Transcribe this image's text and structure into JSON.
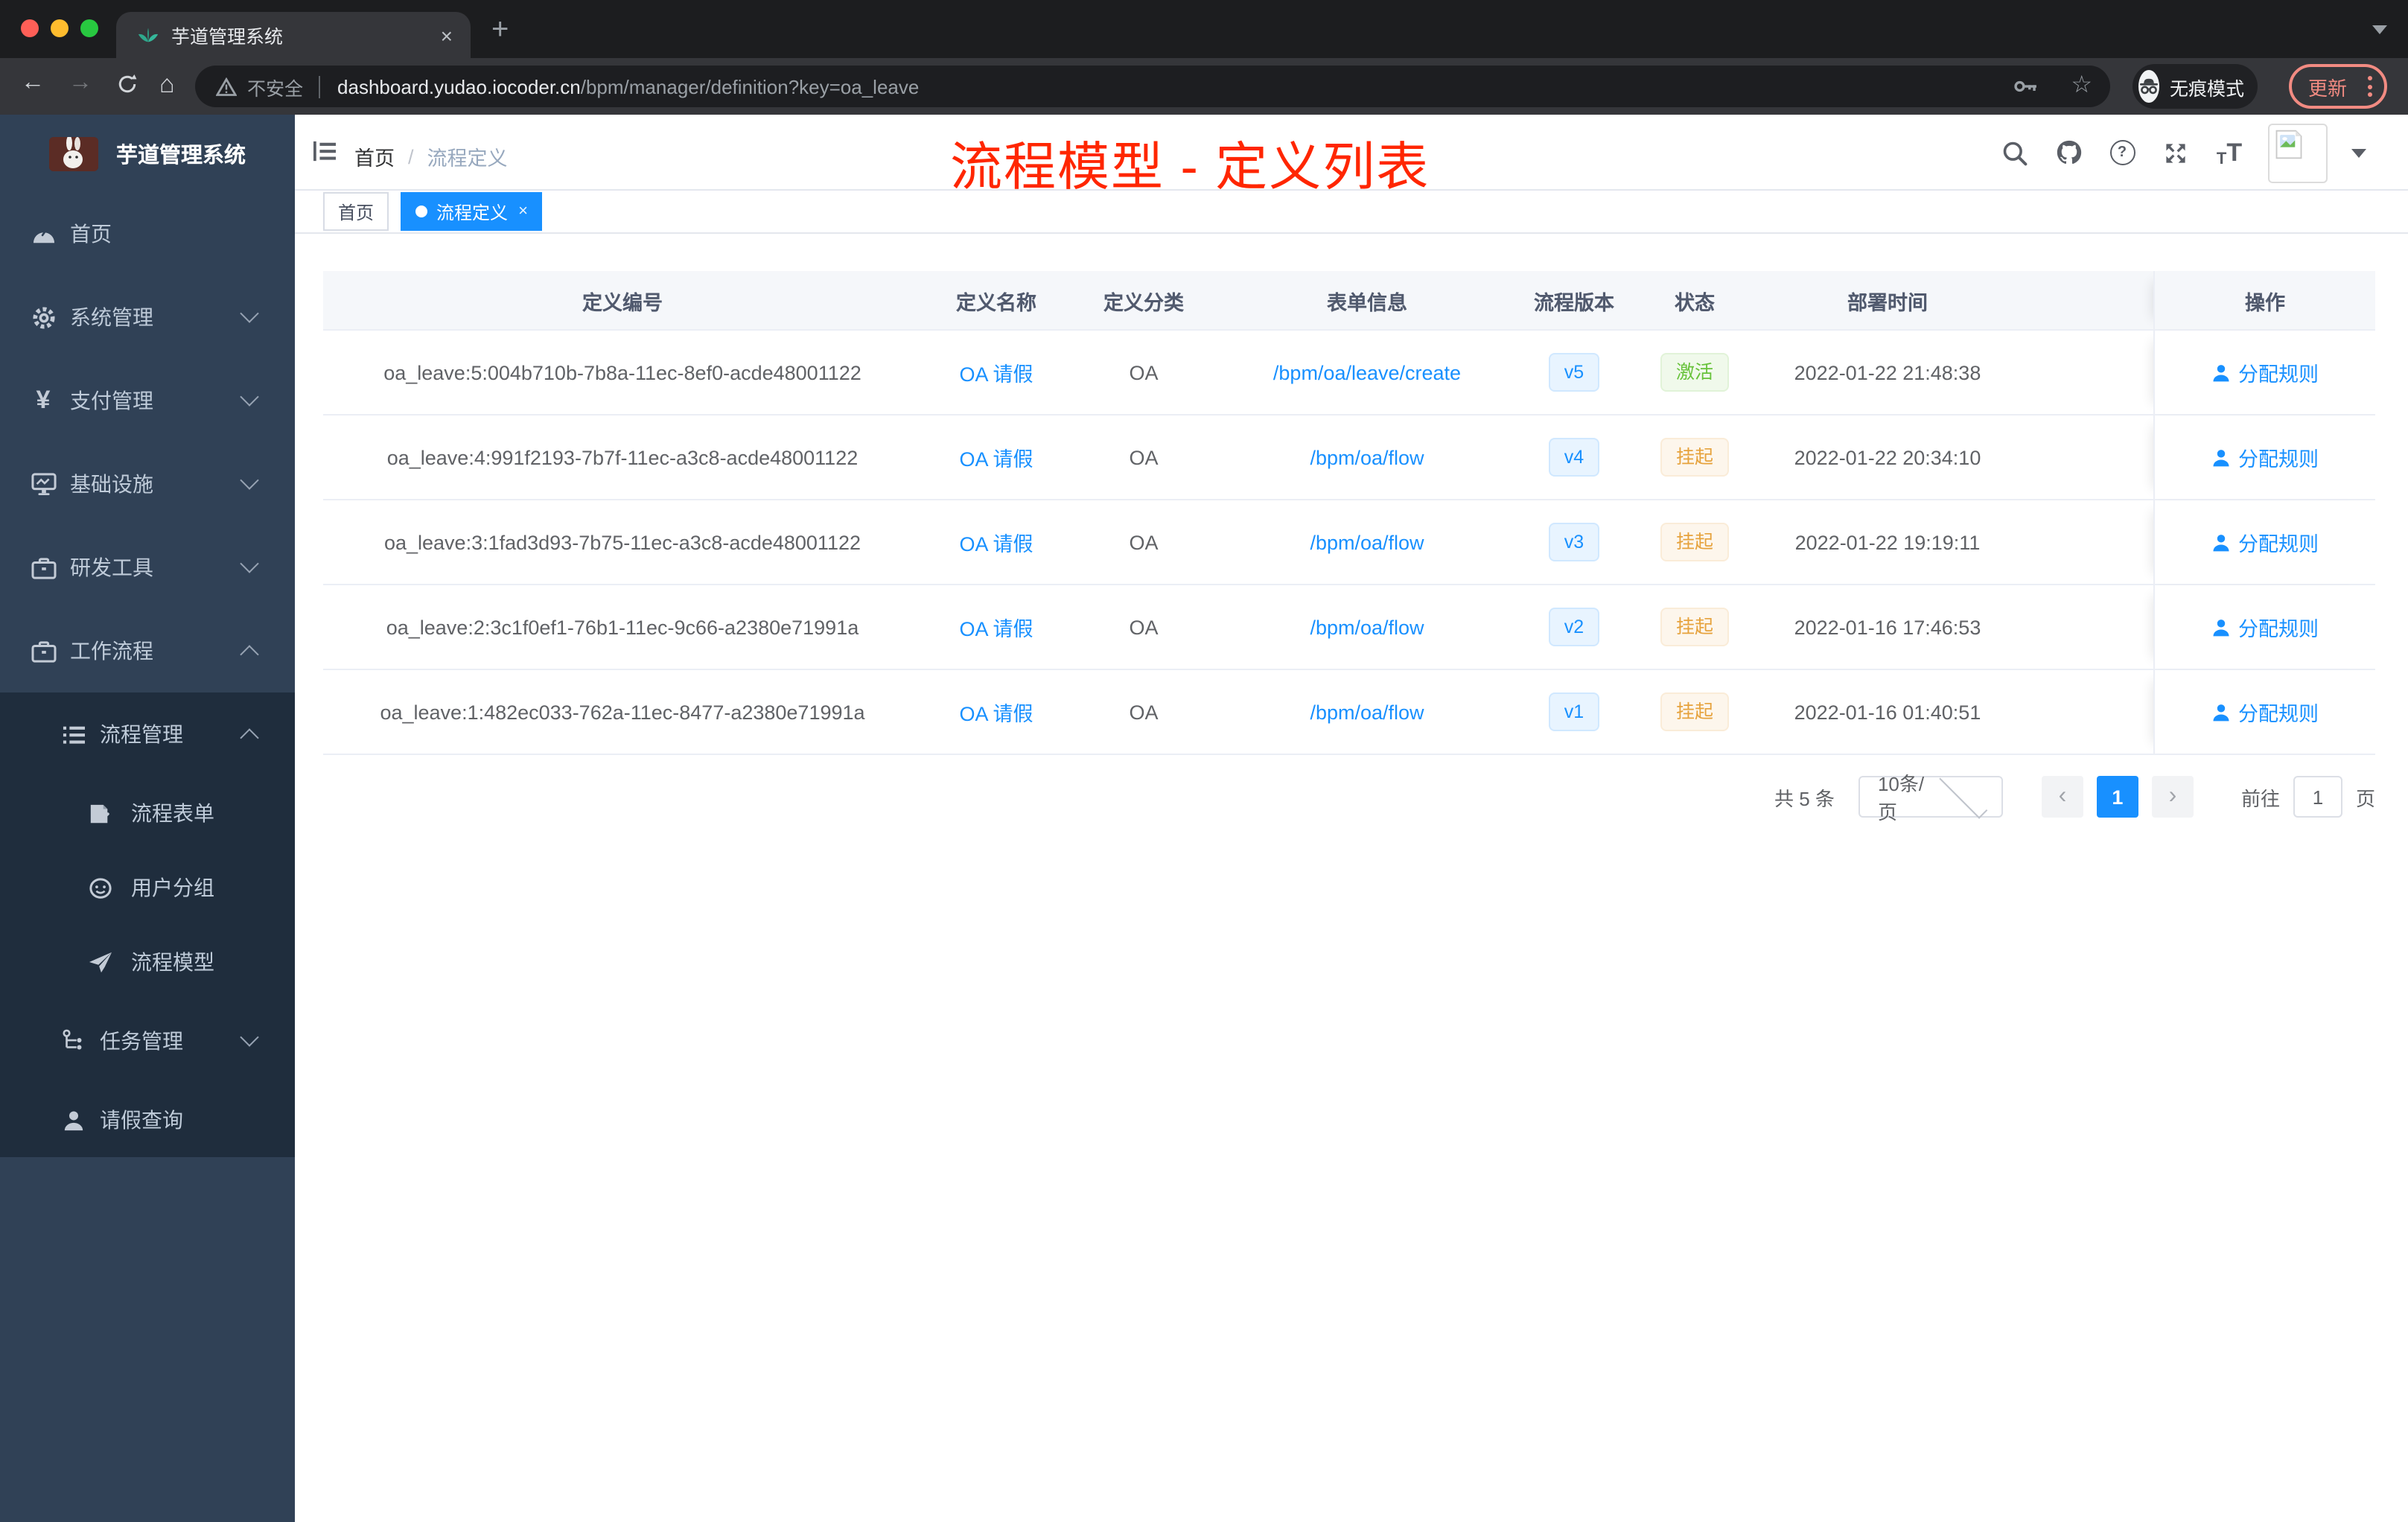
{
  "colors": {
    "accent_blue": "#1890ff",
    "annotation_red": "#ff2600",
    "status_green": "#67c23a",
    "status_orange": "#e6a23c",
    "sidebar_bg": "#304156",
    "submenu_bg": "#1f2d3d"
  },
  "browser": {
    "tab_title": "芋道管理系统",
    "close_tab_glyph": "×",
    "new_tab_glyph": "+",
    "back_glyph": "←",
    "forward_glyph": "→",
    "home_glyph": "⌂",
    "security_label": "不安全",
    "url_domain": "dashboard.yudao.iocoder.cn",
    "url_path": "/bpm/manager/definition?key=oa_leave",
    "star_glyph": "☆",
    "incognito_label": "无痕模式",
    "update_label": "更新"
  },
  "sidebar": {
    "logo_title": "芋道管理系统",
    "items": [
      {
        "label": "首页"
      },
      {
        "label": "系统管理"
      },
      {
        "label": "支付管理"
      },
      {
        "label": "基础设施"
      },
      {
        "label": "研发工具"
      },
      {
        "label": "工作流程"
      }
    ],
    "process_group": {
      "label": "流程管理"
    },
    "process_children": [
      {
        "label": "流程表单"
      },
      {
        "label": "用户分组"
      },
      {
        "label": "流程模型"
      }
    ],
    "task_group": {
      "label": "任务管理"
    },
    "leave_item": {
      "label": "请假查询"
    }
  },
  "navbar": {
    "breadcrumb_home": "首页",
    "breadcrumb_sep": "/",
    "breadcrumb_current": "流程定义",
    "annotation": "流程模型 - 定义列表",
    "help_glyph": "?",
    "font_icon_small": "T",
    "font_icon_large": "T"
  },
  "tags": {
    "home": "首页",
    "active": "流程定义",
    "close_glyph": "×"
  },
  "table": {
    "headers": [
      "定义编号",
      "定义名称",
      "定义分类",
      "表单信息",
      "流程版本",
      "状态",
      "部署时间",
      "操作"
    ],
    "rows": [
      {
        "id": "oa_leave:5:004b710b-7b8a-11ec-8ef0-acde48001122",
        "name": "OA 请假",
        "category": "OA",
        "form": "/bpm/oa/leave/create",
        "version": "v5",
        "status": "激活",
        "status_type": "success",
        "time": "2022-01-22 21:48:38",
        "action": "分配规则"
      },
      {
        "id": "oa_leave:4:991f2193-7b7f-11ec-a3c8-acde48001122",
        "name": "OA 请假",
        "category": "OA",
        "form": "/bpm/oa/flow",
        "version": "v4",
        "status": "挂起",
        "status_type": "warning",
        "time": "2022-01-22 20:34:10",
        "action": "分配规则"
      },
      {
        "id": "oa_leave:3:1fad3d93-7b75-11ec-a3c8-acde48001122",
        "name": "OA 请假",
        "category": "OA",
        "form": "/bpm/oa/flow",
        "version": "v3",
        "status": "挂起",
        "status_type": "warning",
        "time": "2022-01-22 19:19:11",
        "action": "分配规则"
      },
      {
        "id": "oa_leave:2:3c1f0ef1-76b1-11ec-9c66-a2380e71991a",
        "name": "OA 请假",
        "category": "OA",
        "form": "/bpm/oa/flow",
        "version": "v2",
        "status": "挂起",
        "status_type": "warning",
        "time": "2022-01-16 17:46:53",
        "action": "分配规则"
      },
      {
        "id": "oa_leave:1:482ec033-762a-11ec-8477-a2380e71991a",
        "name": "OA 请假",
        "category": "OA",
        "form": "/bpm/oa/flow",
        "version": "v1",
        "status": "挂起",
        "status_type": "warning",
        "time": "2022-01-16 01:40:51",
        "action": "分配规则"
      }
    ]
  },
  "pagination": {
    "total": "共 5 条",
    "page_size": "10条/页",
    "prev_glyph": "‹",
    "next_glyph": "›",
    "page": "1",
    "goto_label": "前往",
    "goto_value": "1",
    "unit_label": "页"
  }
}
